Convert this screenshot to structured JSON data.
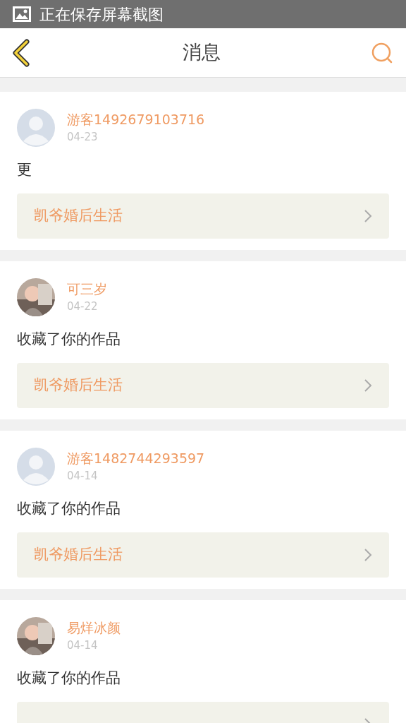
{
  "status_bar": {
    "text": "正在保存屏幕截图"
  },
  "header": {
    "title": "消息"
  },
  "messages": [
    {
      "avatar": {
        "kind": "default"
      },
      "name": "游客1492679103716",
      "date": "04-23",
      "text": "更",
      "link": "凯爷婚后生活"
    },
    {
      "name": "可三岁",
      "date": "04-22",
      "text": "收藏了你的作品",
      "link": "凯爷婚后生活"
    },
    {
      "avatar": {
        "kind": "default"
      },
      "name": "游客1482744293597",
      "date": "04-14",
      "text": "收藏了你的作品",
      "link": "凯爷婚后生活"
    },
    {
      "name": "易烊冰颜",
      "date": "04-14",
      "text": "收藏了你的作品"
    }
  ]
}
